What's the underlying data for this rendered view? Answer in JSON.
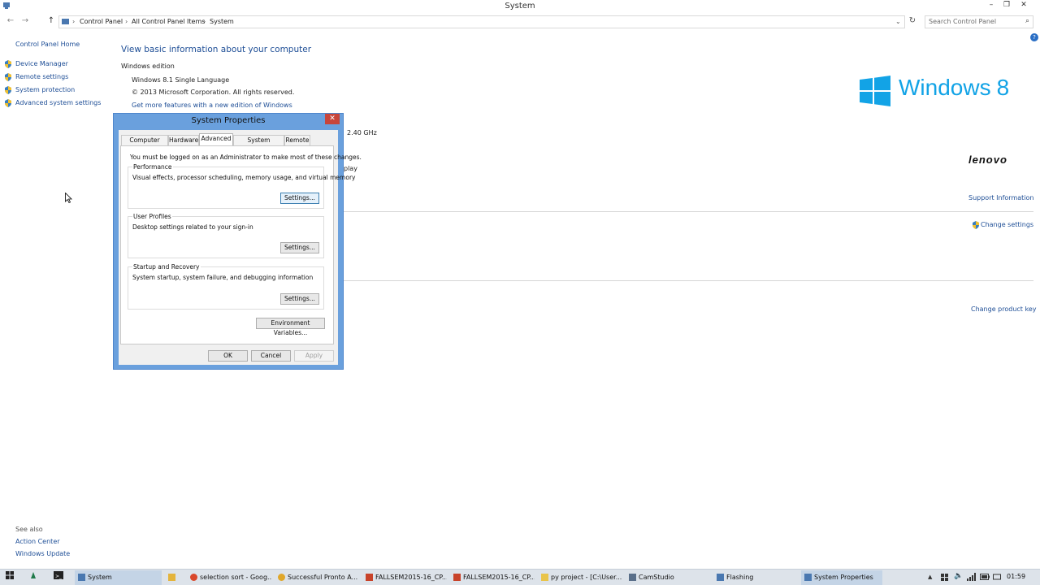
{
  "window": {
    "title": "System",
    "minimize": "–",
    "restore": "❐",
    "close": "✕"
  },
  "address": {
    "segments": [
      "Control Panel",
      "All Control Panel Items",
      "System"
    ],
    "sep": "›",
    "search_placeholder": "Search Control Panel"
  },
  "sidebar": {
    "home": "Control Panel Home",
    "items": [
      "Device Manager",
      "Remote settings",
      "System protection",
      "Advanced system settings"
    ],
    "see_also_heading": "See also",
    "see_also": [
      "Action Center",
      "Windows Update"
    ]
  },
  "main": {
    "heading": "View basic information about your computer",
    "edition_heading": "Windows edition",
    "edition": "Windows 8.1 Single Language",
    "copyright": "© 2013 Microsoft Corporation. All rights reserved.",
    "more_features_link": "Get more features with a new edition of Windows",
    "processor_speed": "2.40 GHz",
    "display_fragment": "play",
    "windows_logo_text": "Windows",
    "windows_logo_version": "8",
    "oem_logo_text": "lenovo",
    "support_link": "Support Information",
    "change_settings_link": "Change settings",
    "change_key_link": "Change product key"
  },
  "dialog": {
    "title": "System Properties",
    "close": "✕",
    "tabs": [
      "Computer Name",
      "Hardware",
      "Advanced",
      "System Protection",
      "Remote"
    ],
    "active_tab": "Advanced",
    "admin_note": "You must be logged on as an Administrator to make most of these changes.",
    "groups": [
      {
        "title": "Performance",
        "desc": "Visual effects, processor scheduling, memory usage, and virtual memory",
        "button": "Settings..."
      },
      {
        "title": "User Profiles",
        "desc": "Desktop settings related to your sign-in",
        "button": "Settings..."
      },
      {
        "title": "Startup and Recovery",
        "desc": "System startup, system failure, and debugging information",
        "button": "Settings..."
      }
    ],
    "env_button": "Environment Variables...",
    "ok": "OK",
    "cancel": "Cancel",
    "apply": "Apply"
  },
  "taskbar": {
    "items": [
      "System",
      "selection sort - Goog...",
      "Successful Pronto A...",
      "FALLSEM2015-16_CP...",
      "FALLSEM2015-16_CP...",
      "py project - [C:\\User...",
      "CamStudio",
      "Flashing",
      "System Properties"
    ],
    "clock": "01:59"
  },
  "colors": {
    "link": "#1e4e96",
    "windows_logo": "#12a3e6",
    "dialog_frame": "#6aa0dd",
    "close_red": "#c8453a"
  }
}
